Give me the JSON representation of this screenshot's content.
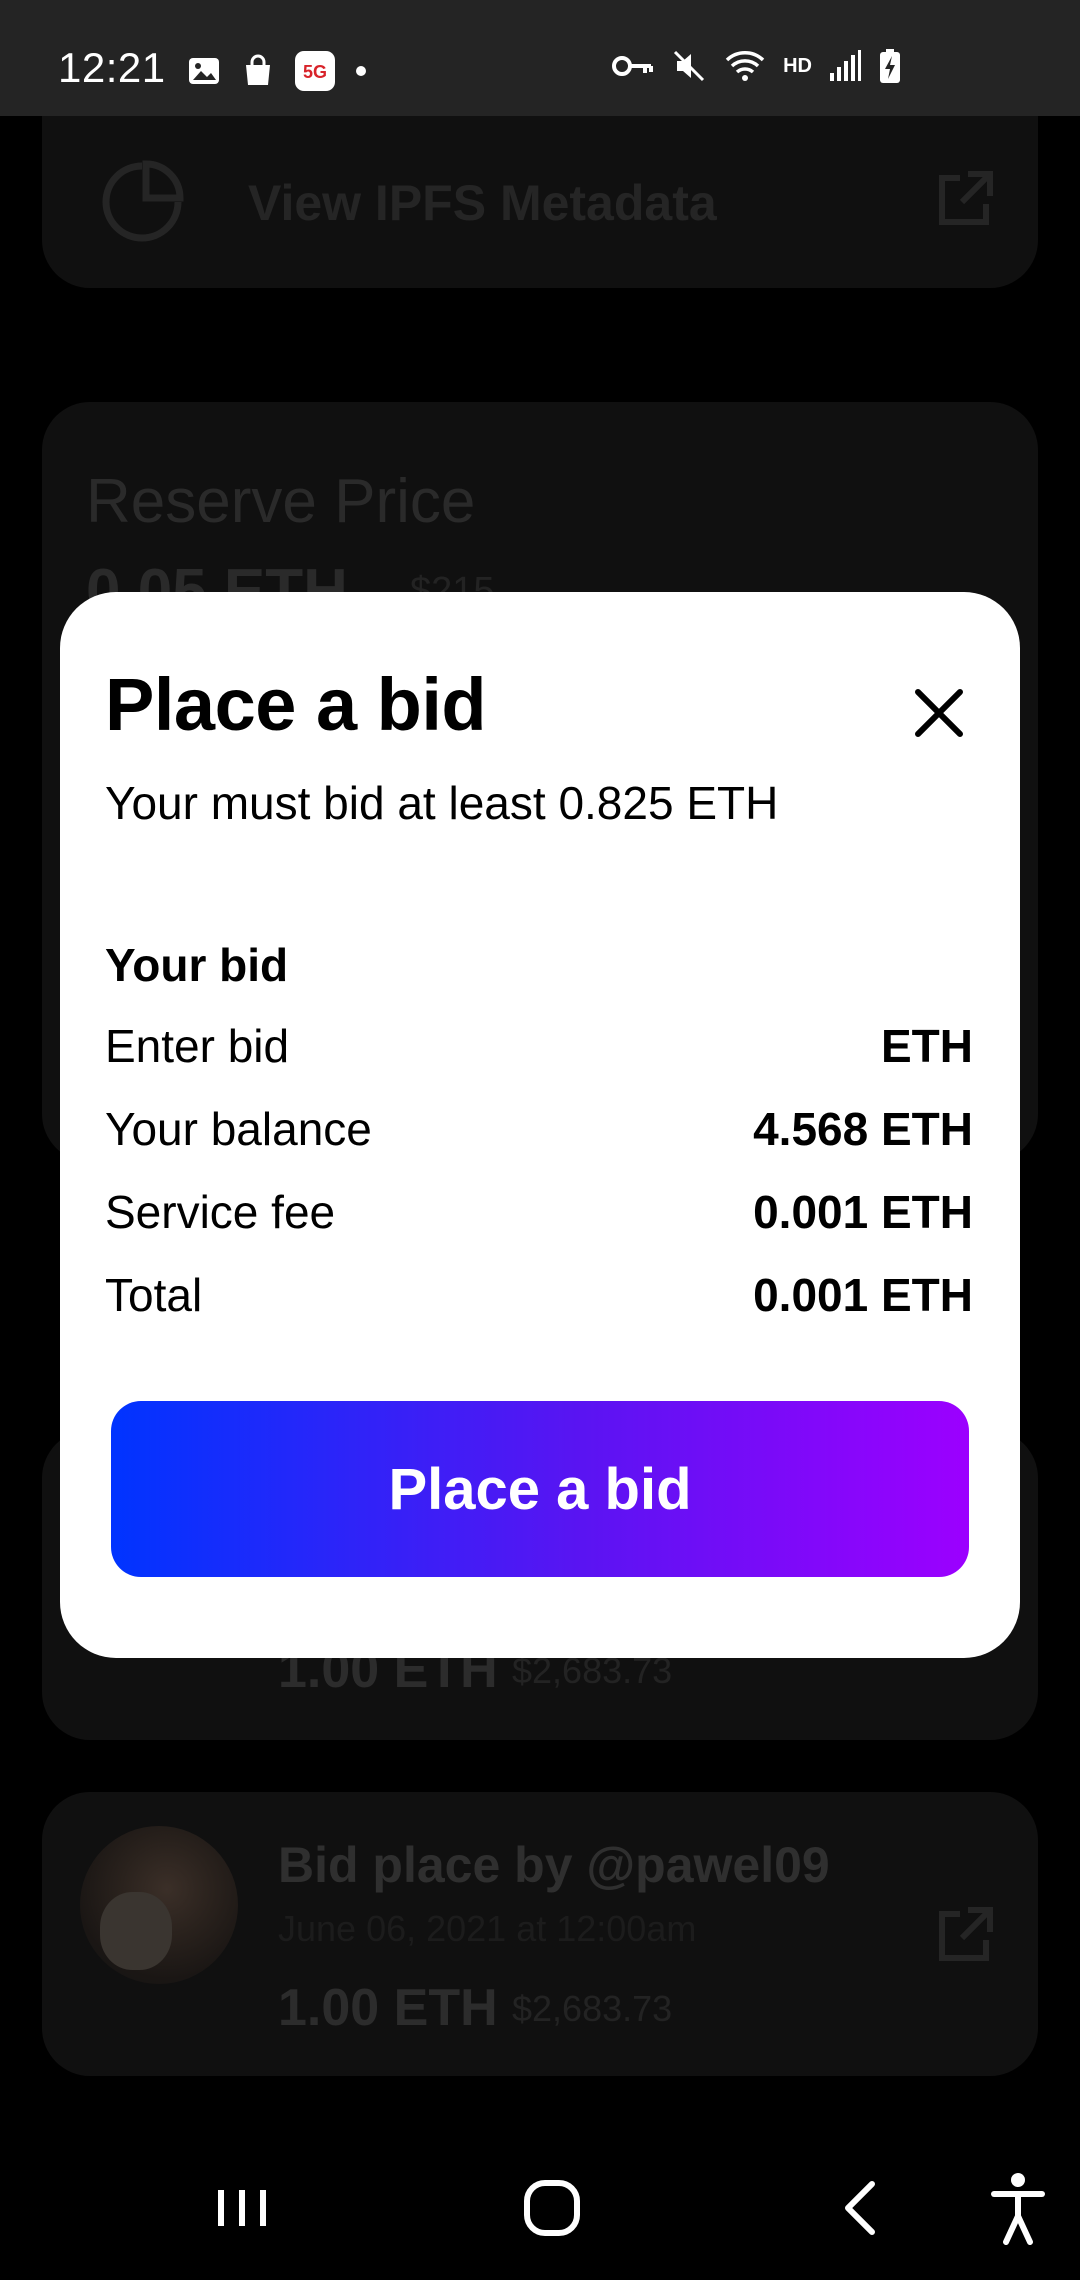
{
  "status_bar": {
    "time": "12:21",
    "network_label": "HD"
  },
  "background": {
    "ipfs_label": "View IPFS Metadata",
    "reserve_label": "Reserve Price",
    "reserve_value": "0.05 ETH",
    "reserve_usd": "$215",
    "bid_1": {
      "amount": "1.00 ETH",
      "usd": "$2,683.73"
    },
    "bid_2": {
      "title": "Bid place by @pawel09",
      "date": "June 06, 2021 at 12:00am",
      "amount": "1.00 ETH",
      "usd": "$2,683.73"
    }
  },
  "modal": {
    "title": "Place a bid",
    "subtitle": "Your must bid at least 0.825 ETH",
    "section_heading": "Your bid",
    "bid_input": {
      "placeholder": "Enter bid",
      "value": "",
      "unit": "ETH"
    },
    "balance_label": "Your balance",
    "balance_value": "4.568 ETH",
    "fee_label": "Service fee",
    "fee_value": "0.001 ETH",
    "total_label": "Total",
    "total_value": "0.001 ETH",
    "submit_label": "Place a bid"
  },
  "colors": {
    "button_gradient_start": "#0034ff",
    "button_gradient_end": "#9c00ff",
    "status_bar_bg": "#242424",
    "modal_bg": "#ffffff"
  },
  "icons": {
    "close": "close-icon",
    "ipfs": "pie-chart-icon",
    "external": "external-link-icon",
    "nav": [
      "recents-icon",
      "home-icon",
      "back-icon",
      "accessibility-icon"
    ]
  }
}
